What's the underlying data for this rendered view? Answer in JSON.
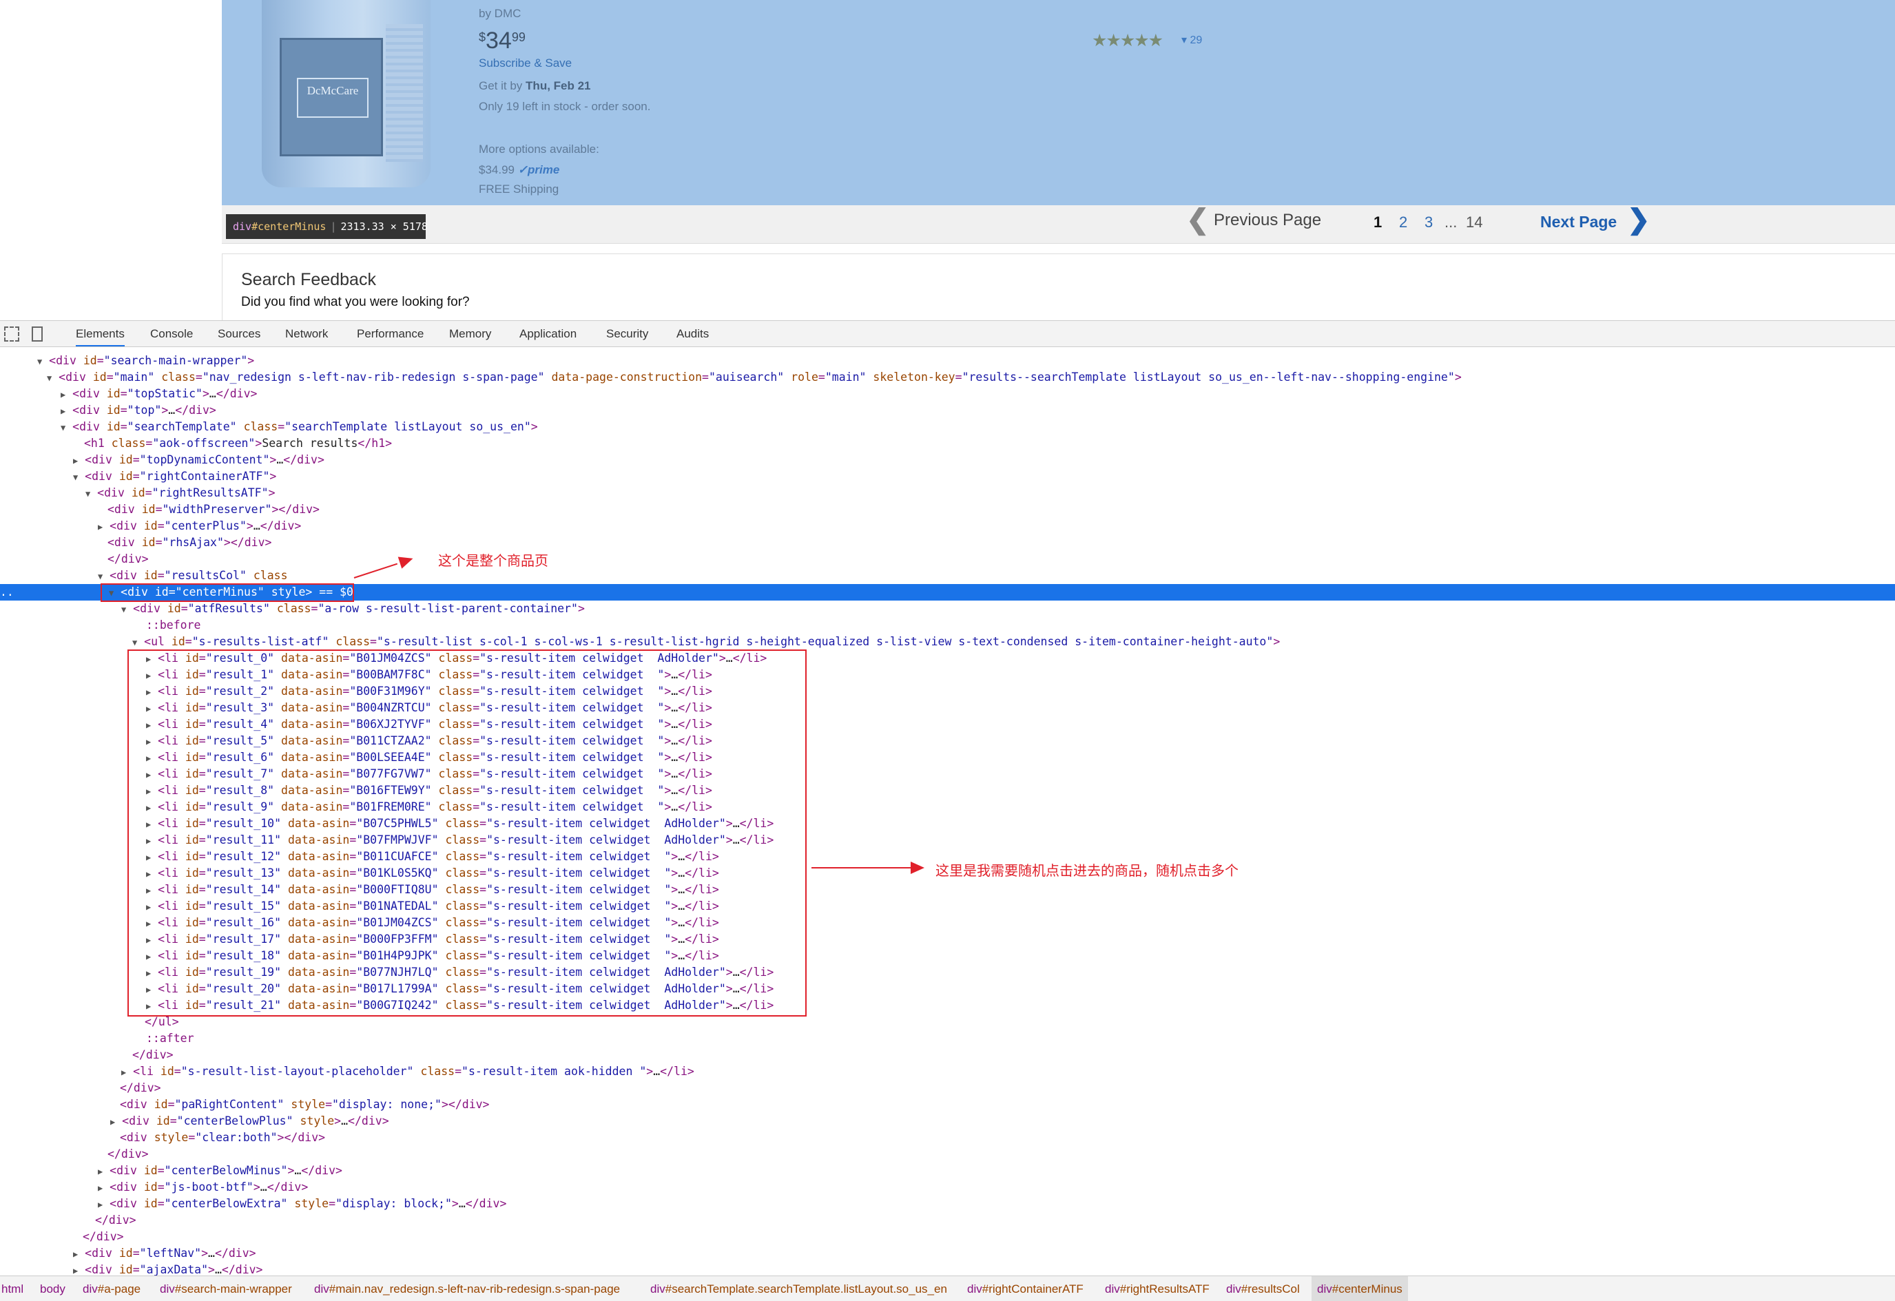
{
  "product": {
    "brand": "by DMC",
    "price_currency": "$",
    "price_whole": "34",
    "price_fraction": "99",
    "subscribe": "Subscribe & Save",
    "delivery_prefix": "Get it by",
    "delivery_date": "Thu, Feb 21",
    "stock": "Only 19 left in stock - order soon.",
    "more_options": "More options available:",
    "alt_price": "$34.99",
    "prime": "prime",
    "shipping": "FREE Shipping",
    "stars": "★★★★★",
    "rating_count": "29",
    "label_text": "DcMcCare"
  },
  "tooltip": {
    "tag": "div",
    "id": "#centerMinus",
    "size": "2313.33 × 5178"
  },
  "pagination": {
    "prev": "Previous Page",
    "pages": [
      "1",
      "2",
      "3",
      "...",
      "14"
    ],
    "next": "Next Page"
  },
  "feedback": {
    "title": "Search Feedback",
    "question": "Did you find what you were looking for?"
  },
  "devtools": {
    "tabs": [
      "Elements",
      "Console",
      "Sources",
      "Network",
      "Performance",
      "Memory",
      "Application",
      "Security",
      "Audits"
    ],
    "active_tab": "Elements"
  },
  "annotations": {
    "page_note": "这个是整个商品页",
    "items_note": "这里是我需要随机点击进去的商品，随机点击多个"
  },
  "results": [
    {
      "id": "result_0",
      "asin": "B01JM04ZCS",
      "cls": "s-result-item celwidget  AdHolder"
    },
    {
      "id": "result_1",
      "asin": "B00BAM7F8C",
      "cls": "s-result-item celwidget  "
    },
    {
      "id": "result_2",
      "asin": "B00F31M96Y",
      "cls": "s-result-item celwidget  "
    },
    {
      "id": "result_3",
      "asin": "B004NZRTCU",
      "cls": "s-result-item celwidget  "
    },
    {
      "id": "result_4",
      "asin": "B06XJ2TYVF",
      "cls": "s-result-item celwidget  "
    },
    {
      "id": "result_5",
      "asin": "B011CTZAA2",
      "cls": "s-result-item celwidget  "
    },
    {
      "id": "result_6",
      "asin": "B00LSEEA4E",
      "cls": "s-result-item celwidget  "
    },
    {
      "id": "result_7",
      "asin": "B077FG7VW7",
      "cls": "s-result-item celwidget  "
    },
    {
      "id": "result_8",
      "asin": "B016FTEW9Y",
      "cls": "s-result-item celwidget  "
    },
    {
      "id": "result_9",
      "asin": "B01FREM0RE",
      "cls": "s-result-item celwidget  "
    },
    {
      "id": "result_10",
      "asin": "B07C5PHWL5",
      "cls": "s-result-item celwidget  AdHolder"
    },
    {
      "id": "result_11",
      "asin": "B07FMPWJVF",
      "cls": "s-result-item celwidget  AdHolder"
    },
    {
      "id": "result_12",
      "asin": "B011CUAFCE",
      "cls": "s-result-item celwidget  "
    },
    {
      "id": "result_13",
      "asin": "B01KL0S5KQ",
      "cls": "s-result-item celwidget  "
    },
    {
      "id": "result_14",
      "asin": "B000FTIQ8U",
      "cls": "s-result-item celwidget  "
    },
    {
      "id": "result_15",
      "asin": "B01NATEDAL",
      "cls": "s-result-item celwidget  "
    },
    {
      "id": "result_16",
      "asin": "B01JM04ZCS",
      "cls": "s-result-item celwidget  "
    },
    {
      "id": "result_17",
      "asin": "B000FP3FFM",
      "cls": "s-result-item celwidget  "
    },
    {
      "id": "result_18",
      "asin": "B01H4P9JPK",
      "cls": "s-result-item celwidget  "
    },
    {
      "id": "result_19",
      "asin": "B077NJH7LQ",
      "cls": "s-result-item celwidget  AdHolder"
    },
    {
      "id": "result_20",
      "asin": "B017L1799A",
      "cls": "s-result-item celwidget  AdHolder"
    },
    {
      "id": "result_21",
      "asin": "B00G7IQ242",
      "cls": "s-result-item celwidget  AdHolder"
    }
  ],
  "breadcrumbs": [
    {
      "tag": "html",
      "cls": ""
    },
    {
      "tag": "body",
      "cls": ""
    },
    {
      "tag": "div",
      "cls": "#a-page"
    },
    {
      "tag": "div",
      "cls": "#search-main-wrapper"
    },
    {
      "tag": "div",
      "cls": "#main.nav_redesign.s-left-nav-rib-redesign.s-span-page"
    },
    {
      "tag": "div",
      "cls": "#searchTemplate.searchTemplate.listLayout.so_us_en"
    },
    {
      "tag": "div",
      "cls": "#rightContainerATF"
    },
    {
      "tag": "div",
      "cls": "#rightResultsATF"
    },
    {
      "tag": "div",
      "cls": "#resultsCol"
    },
    {
      "tag": "div",
      "cls": "#centerMinus"
    }
  ]
}
